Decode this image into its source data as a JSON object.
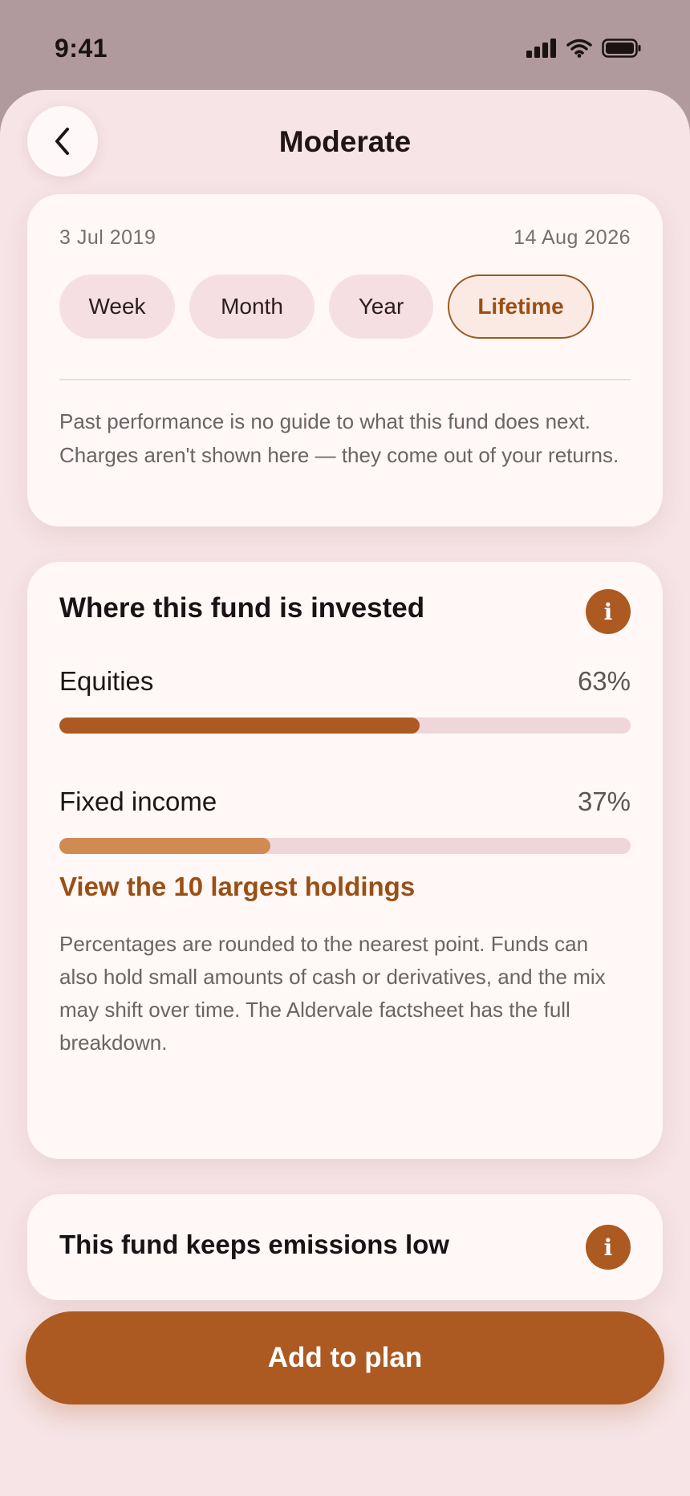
{
  "status_bar": {
    "time": "9:41",
    "icons": [
      "signal-icon",
      "wifi-icon",
      "battery-icon"
    ]
  },
  "header": {
    "title": "Moderate",
    "back_icon": "chevron-left-icon"
  },
  "range": {
    "start_date": "3 Jul 2019",
    "end_date": "14 Aug 2026",
    "chips": [
      {
        "label": "Week",
        "selected": false
      },
      {
        "label": "Month",
        "selected": false
      },
      {
        "label": "Year",
        "selected": false
      },
      {
        "label": "Lifetime",
        "selected": true
      }
    ],
    "disclaimer": "Past performance is no guide to what this fund does next. Charges aren't shown here — they come out of your returns."
  },
  "invested": {
    "title": "Where this fund is invested",
    "info_icon_glyph": "i",
    "allocations": [
      {
        "label": "Equities",
        "value": "63%",
        "fraction": 0.63,
        "color": "#ac5a21"
      },
      {
        "label": "Fixed income",
        "value": "37%",
        "fraction": 0.37,
        "color": "#cf8b52"
      }
    ],
    "holdings_link": "View the 10 largest holdings",
    "note": "Percentages are rounded to the nearest point. Funds can also hold small amounts of cash or derivatives, and the mix may shift over time. The Aldervale factsheet has the full breakdown."
  },
  "emissions": {
    "title": "This fund keeps emissions low",
    "info_icon_glyph": "i"
  },
  "cta": {
    "label": "Add to plan"
  },
  "colors": {
    "accent": "#ac5a21",
    "accent_light": "#cf8b52",
    "background": "#f6e4e6",
    "card": "#fff8f7"
  }
}
